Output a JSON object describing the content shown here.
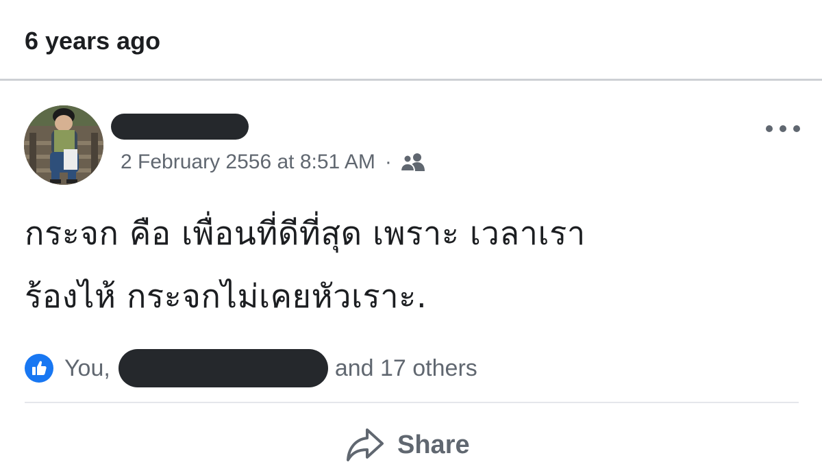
{
  "memory": {
    "heading": "6 years ago"
  },
  "post": {
    "author_name": "",
    "timestamp": "2 February 2556 at 8:51 AM",
    "separator": "·",
    "audience_icon": "friends-icon",
    "text_line_1": "กระจก คือ เพื่อนที่ดีที่สุด เพราะ เวลาเรา",
    "text_line_2": "ร้องไห้ กระจกไม่เคยหัวเราะ."
  },
  "reactions": {
    "icon": "like-icon",
    "you_label": "You,",
    "others_label": "and 17 others"
  },
  "actions": {
    "share_label": "Share"
  },
  "colors": {
    "like_blue": "#1877f2",
    "meta_gray": "#606770",
    "text_dark": "#1c1e21",
    "redaction": "#25282c"
  }
}
